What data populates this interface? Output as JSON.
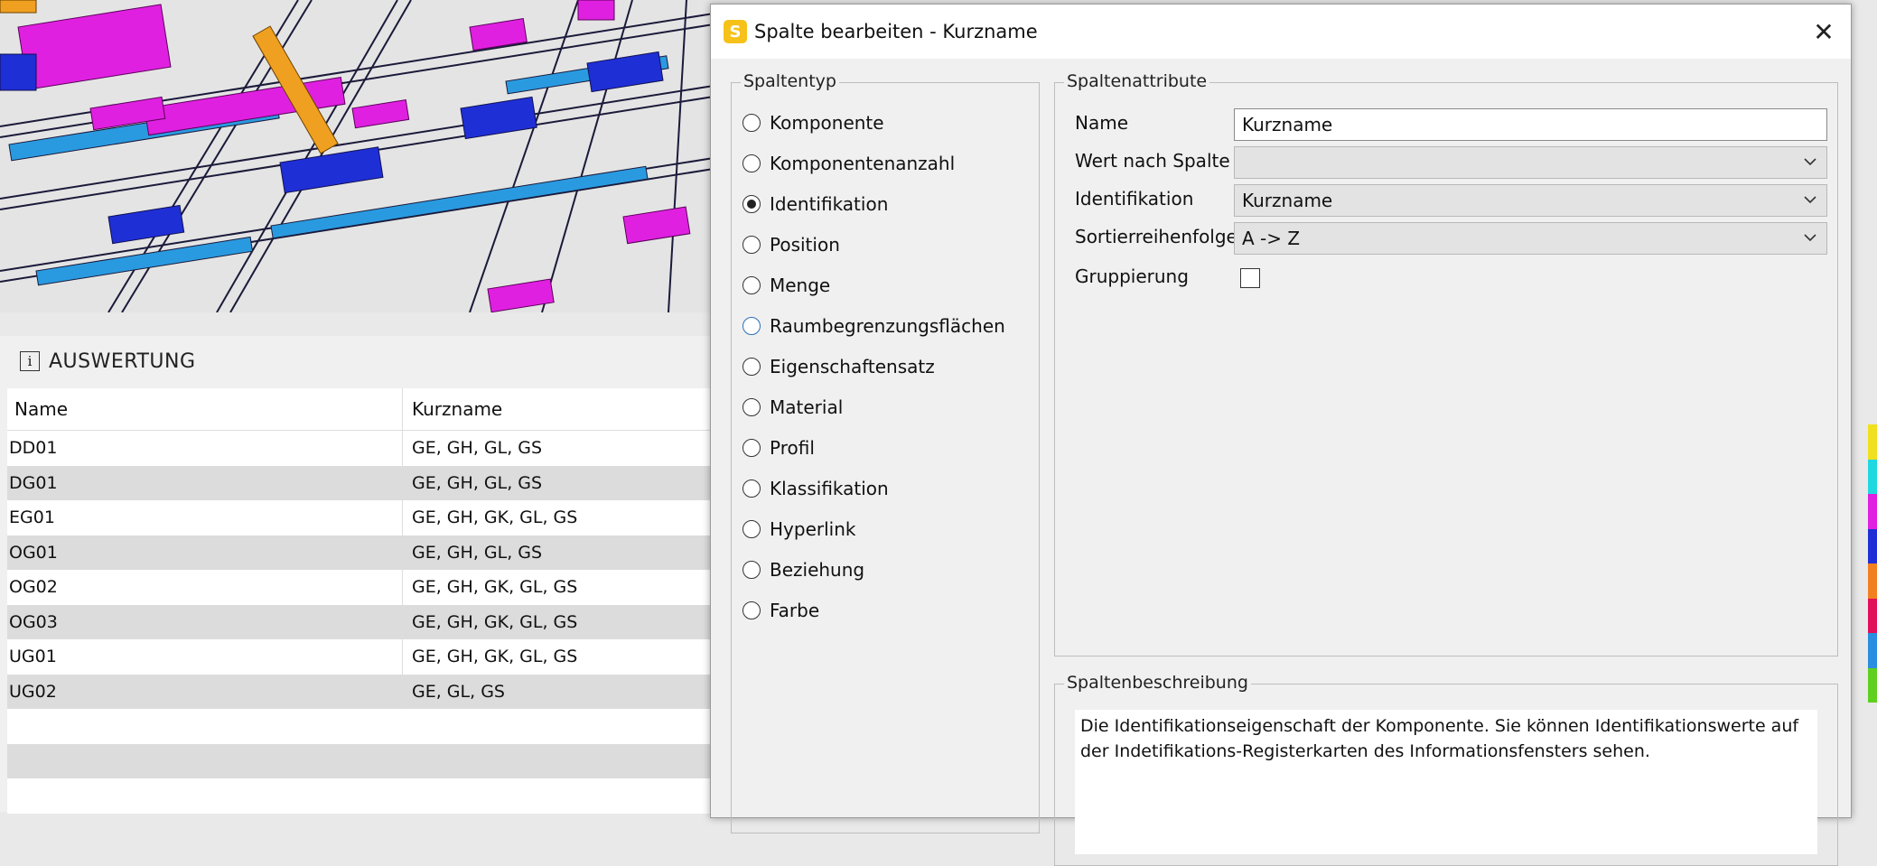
{
  "viewport": {
    "description_icon": "3d-model-view"
  },
  "panel": {
    "title": "AUSWERTUNG",
    "icon": "info-icon",
    "columns": [
      "Name",
      "Kurzname"
    ],
    "rows": [
      [
        "DD01",
        "GE, GH, GL, GS"
      ],
      [
        "DG01",
        "GE, GH, GL, GS"
      ],
      [
        "EG01",
        "GE, GH, GK, GL, GS"
      ],
      [
        "OG01",
        "GE, GH, GL, GS"
      ],
      [
        "OG02",
        "GE, GH, GK, GL, GS"
      ],
      [
        "OG03",
        "GE, GH, GK, GL, GS"
      ],
      [
        "UG01",
        "GE, GH, GK, GL, GS"
      ],
      [
        "UG02",
        "GE, GL, GS"
      ]
    ]
  },
  "dialog": {
    "title": "Spalte bearbeiten - Kurzname",
    "app_icon_letter": "S",
    "close_glyph": "✕",
    "spaltentyp": {
      "legend": "Spaltentyp",
      "options": [
        "Komponente",
        "Komponentenanzahl",
        "Identifikation",
        "Position",
        "Menge",
        "Raumbegrenzungsflächen",
        "Eigenschaftensatz",
        "Material",
        "Profil",
        "Klassifikation",
        "Hyperlink",
        "Beziehung",
        "Farbe"
      ],
      "selected": "Identifikation",
      "hovered": "Raumbegrenzungsflächen"
    },
    "attribute": {
      "legend": "Spaltenattribute",
      "name_label": "Name",
      "name_value": "Kurzname",
      "wert_label": "Wert nach Spalte",
      "wert_value": "",
      "ident_label": "Identifikation",
      "ident_value": "Kurzname",
      "sort_label": "Sortierreihenfolge",
      "sort_value": "A -> Z",
      "group_label": "Gruppierung",
      "group_checked": false
    },
    "beschreibung": {
      "legend": "Spaltenbeschreibung",
      "text": "Die Identifikationseigenschaft der Komponente. Sie können Identifikationswerte auf der Indetifikations-Registerkarten des Informationsfensters sehen."
    }
  },
  "colors": {
    "magenta": "#e020e0",
    "blue": "#1f2fd6",
    "cyan": "#28a0e0",
    "orange": "#f0a020",
    "strip": [
      "#f0e020",
      "#20d8e0",
      "#e020e0",
      "#1f2fd6",
      "#f08020",
      "#e0105a",
      "#2a8ee0",
      "#60d020"
    ]
  }
}
